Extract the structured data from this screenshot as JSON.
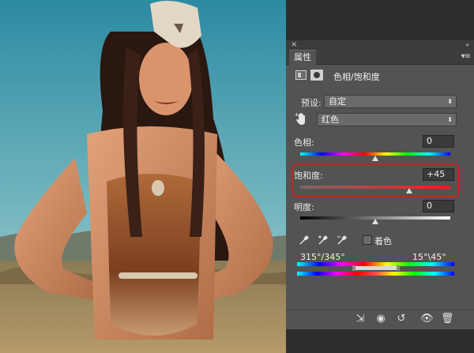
{
  "panel": {
    "close_glyph": "×",
    "collapse_glyph": "«",
    "tab_label": "属性",
    "menu_glyph": "▾≡",
    "adjustment_title": "色相/饱和度"
  },
  "preset": {
    "label": "预设:",
    "value": "自定"
  },
  "channel": {
    "value": "红色"
  },
  "hue": {
    "label": "色相:",
    "value": "0",
    "level": 0
  },
  "saturation": {
    "label": "饱和度:",
    "value": "+45",
    "level": 45
  },
  "lightness": {
    "label": "明度:",
    "value": "0",
    "level": 0
  },
  "colorize": {
    "label": "着色",
    "checked": false
  },
  "range": {
    "left": "315°/345°",
    "right": "15°\\45°"
  },
  "colors": {
    "panel_bg": "#535353",
    "highlight": "#d02020",
    "sky_top": "#2f8ea5",
    "sky_bottom": "#8fc3c8"
  },
  "icons": {
    "bottom_bar": [
      "clip-to-layer-icon",
      "view-previous-icon",
      "reset-icon",
      "visibility-icon",
      "delete-icon"
    ]
  }
}
